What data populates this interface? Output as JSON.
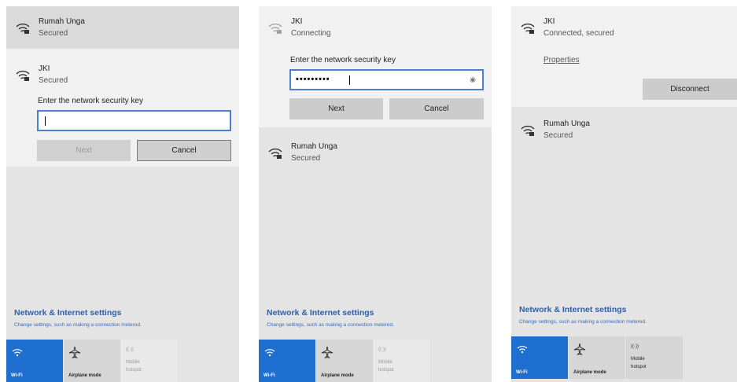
{
  "colors": {
    "accent": "#1f6fd1",
    "panel_bg": "#e4e4e4",
    "link": "#2e5fa8"
  },
  "panel1": {
    "networks": [
      {
        "ssid": "Rumah Unga",
        "status": "Secured",
        "icon": "wifi-secured-icon"
      },
      {
        "ssid": "JKI",
        "status": "Secured",
        "icon": "wifi-secured-icon"
      }
    ],
    "key_label": "Enter the network security key",
    "key_value": "",
    "next_label": "Next",
    "cancel_label": "Cancel"
  },
  "panel2": {
    "networks": [
      {
        "ssid": "JKI",
        "status": "Connecting",
        "icon": "wifi-secured-icon"
      },
      {
        "ssid": "Rumah Unga",
        "status": "Secured",
        "icon": "wifi-secured-icon"
      }
    ],
    "key_label": "Enter the network security key",
    "key_value": "•••••••••",
    "reveal_icon": "eye-icon",
    "next_label": "Next",
    "cancel_label": "Cancel"
  },
  "panel3": {
    "networks": [
      {
        "ssid": "JKI",
        "status": "Connected, secured",
        "icon": "wifi-secured-icon"
      },
      {
        "ssid": "Rumah Unga",
        "status": "Secured",
        "icon": "wifi-secured-icon"
      }
    ],
    "properties_label": "Properties",
    "disconnect_label": "Disconnect"
  },
  "settings": {
    "title": "Network & Internet settings",
    "subtitle": "Change settings, such as making a connection metered."
  },
  "quick_actions": {
    "wifi": {
      "label": "Wi-Fi",
      "icon": "wifi-icon",
      "state": "on"
    },
    "airplane": {
      "label": "Airplane mode",
      "icon": "airplane-icon",
      "state": "off"
    },
    "hotspot": {
      "label": "Mobile hotspot",
      "line1": "Mobile",
      "line2": "hotspot",
      "icon": "hotspot-icon"
    }
  }
}
